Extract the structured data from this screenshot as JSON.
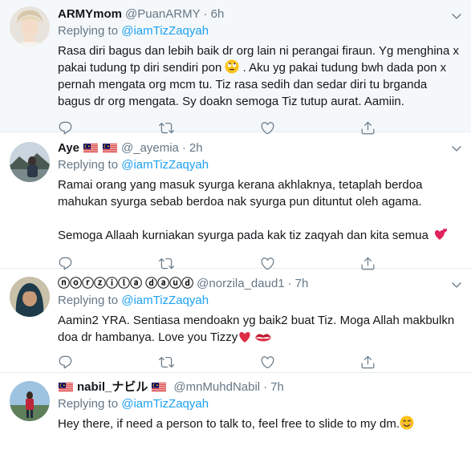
{
  "tweets": [
    {
      "name": "ARMYmom",
      "handle": "@PuanARMY",
      "time": "6h",
      "replying_prefix": "Replying to",
      "replying_to": "@iamTizZaqyah",
      "text_parts": [
        "Rasa diri bagus dan lebih baik dr org lain ni perangai firaun. Yg menghina x pakai tudung tp diri sendiri pon",
        ". Aku yg pakai tudung bwh dada pon x pernah mengata org mcm tu. Tiz rasa sedih dan sedar diri tu brganda bagus dr org mengata. Sy doakn semoga Tiz tutup aurat. Aamiin."
      ],
      "emoji": [
        "eye-roll-emoji"
      ]
    },
    {
      "name": "Aye",
      "handle": "@_ayemia",
      "time": "2h",
      "replying_prefix": "Replying to",
      "replying_to": "@iamTizZaqyah",
      "paragraph1": "Ramai orang yang masuk syurga kerana akhlaknya, tetaplah berdoa mahukan syurga sebab berdoa nak syurga pun dituntut oleh agama.",
      "paragraph2": "Semoga Allaah kurniakan syurga pada kak tiz zaqyah dan kita semua",
      "emoji": [
        "flag-malaysia",
        "flag-malaysia",
        "two-hearts-emoji"
      ]
    },
    {
      "name": "ⓝⓞⓡⓩⓘⓛⓐ ⓓⓐⓤⓓ",
      "handle": "@norzila_daud1",
      "time": "7h",
      "replying_prefix": "Replying to",
      "replying_to": "@iamTizZaqyah",
      "text": "Aamin2 YRA. Sentiasa mendoakn yg baik2 buat Tiz. Moga Allah makbulkn doa dr hambanya. Love you Tizzy",
      "emoji": [
        "red-heart-emoji",
        "kiss-mark-emoji"
      ]
    },
    {
      "name": "nabil_ナビル",
      "handle": "@mnMuhdNabil",
      "time": "7h",
      "replying_prefix": "Replying to",
      "replying_to": "@iamTizZaqyah",
      "text": "Hey there, if need a person to talk to, feel free to slide to my dm.",
      "emoji": [
        "flag-malaysia",
        "flag-malaysia",
        "smiling-face-emoji"
      ]
    }
  ],
  "separator": "·",
  "colors": {
    "accent": "#1da1f2",
    "secondary": "#657786",
    "highlight_bg": "#f5f8fa",
    "border": "#e6ecf0"
  }
}
